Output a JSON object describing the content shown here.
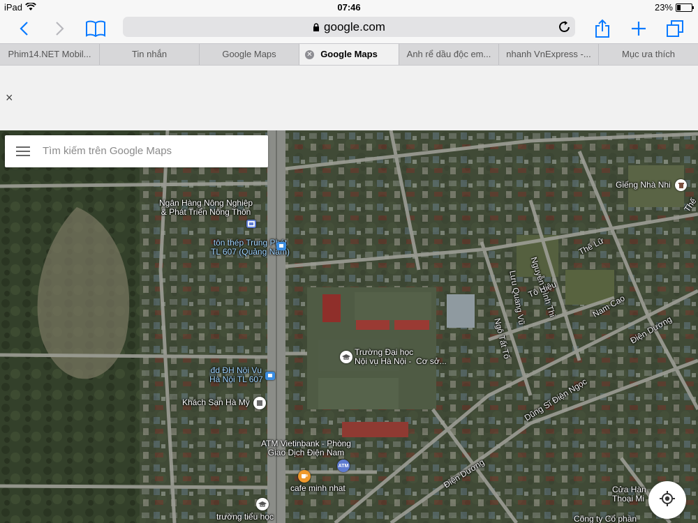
{
  "status_bar": {
    "device": "iPad",
    "time": "07:46",
    "battery": "23%",
    "battery_level": 0.23
  },
  "toolbar": {
    "url": "google.com"
  },
  "tabs": [
    {
      "label": "Phim14.NET Mobil..."
    },
    {
      "label": "Tin nhắn"
    },
    {
      "label": "Google Maps"
    },
    {
      "label": "Google Maps"
    },
    {
      "label": "Anh rể dầu độc em..."
    },
    {
      "label": "nhanh VnExpress -..."
    },
    {
      "label": "Mục ưa thích"
    }
  ],
  "active_tab_index": 3,
  "banner": {
    "close": "×"
  },
  "map": {
    "search_placeholder": "Tìm kiếm trên Google Maps",
    "places": {
      "bank": "Ngân Hàng Nông Nghiệp\n& Phát Triển Nông Thôn",
      "steel": "tôn thép Trung Phát\nTL 607 (Quảng Nam)",
      "univ": "Trường Đại học\nNội vụ Hà Nội -  Cơ sở...",
      "stop": "đd ĐH Nội Vụ\nHà Nội TL 607",
      "hotel": "Khách Sạn Hà My",
      "atm": "ATM Vietinbank - Phòng\nGiao Dịch Điện Nam",
      "cafe": "cafe minh nhat",
      "school": "trường tiểu học",
      "well": "Giếng Nhà Nhi",
      "shop": "Cửa Hàn\nThoại Mi",
      "company": "Công ty Cổ phần",
      "the_edge": "Thế"
    },
    "streets": {
      "the_lu": "Thế Lữ",
      "nguyen_dinh_thi": "Nguyễn Đình Thi",
      "luu_quang_vu": "Lưu Quang Vũ",
      "to_hieu": "Tô Hiệu",
      "ngo_tat_to": "Ngô Tất Tố",
      "nam_cao": "Nam Cao",
      "dien_duong_1": "Điện Dương",
      "dung_si": "Dũng Sĩ Điện Ngọc",
      "dien_duong_2": "Điện Dương"
    }
  }
}
